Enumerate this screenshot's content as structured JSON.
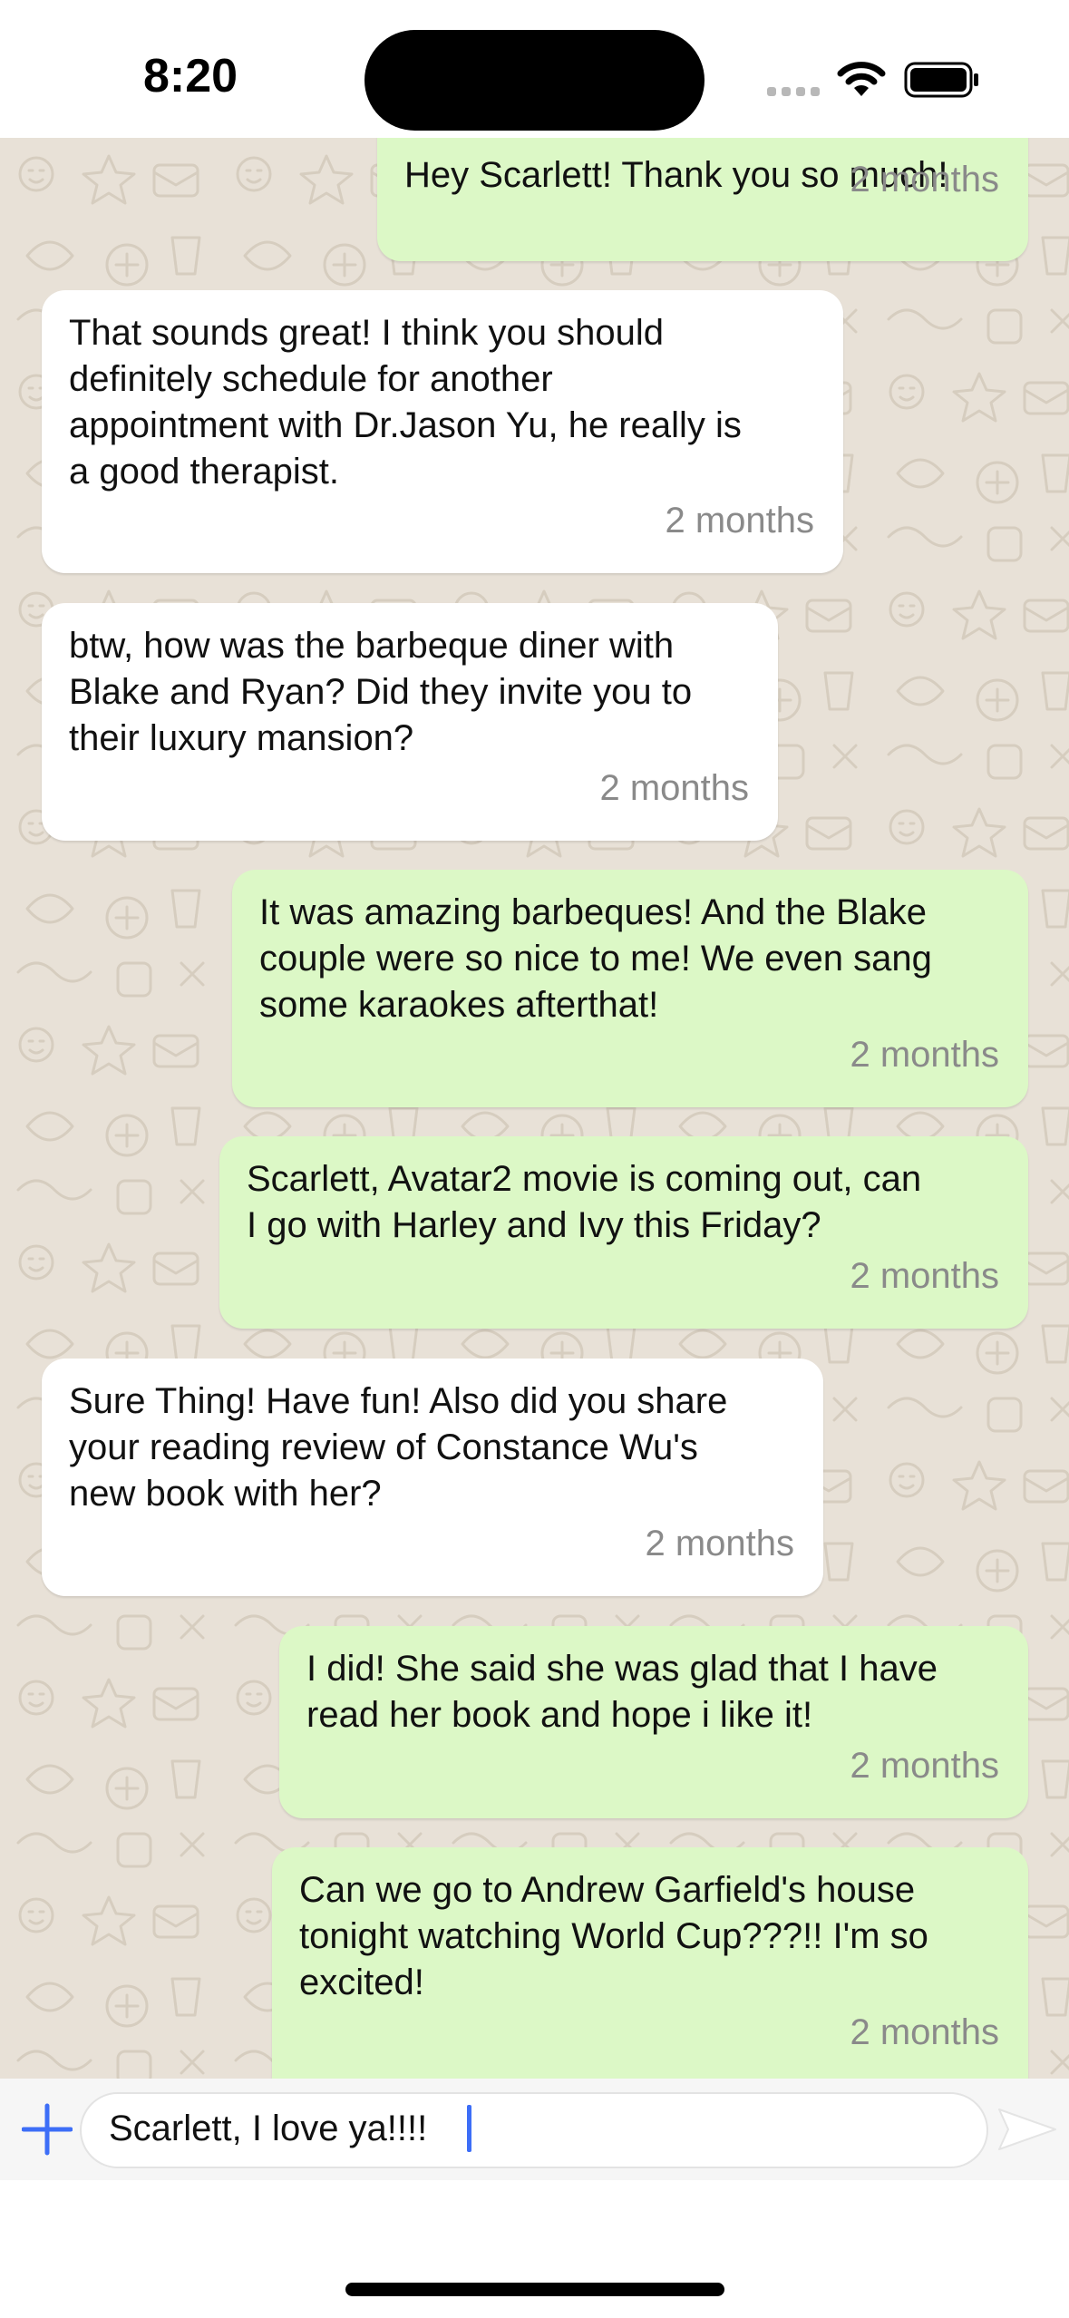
{
  "status_bar": {
    "time": "8:20"
  },
  "messages": [
    {
      "direction": "outgoing",
      "text": "Hey Scarlett! Thank you so much!",
      "time": "2 months"
    },
    {
      "direction": "incoming",
      "text": "That sounds great! I think you should\ndefinitely schedule for another\nappointment with Dr.Jason Yu, he really is\na good therapist.",
      "time": "2 months"
    },
    {
      "direction": "incoming",
      "text": "btw, how was the barbeque diner with\nBlake and Ryan? Did they invite you to\ntheir luxury mansion?",
      "time": "2 months"
    },
    {
      "direction": "outgoing",
      "text": "It was amazing barbeques! And the Blake\ncouple were so nice to me! We even sang\nsome karaokes afterthat!",
      "time": "2 months"
    },
    {
      "direction": "outgoing",
      "text": "Scarlett, Avatar2 movie is coming out, can\nI go with Harley and Ivy this Friday?",
      "time": "2 months"
    },
    {
      "direction": "incoming",
      "text": "Sure Thing! Have fun! Also did you share\nyour reading review of Constance Wu's\nnew book with her?",
      "time": "2 months"
    },
    {
      "direction": "outgoing",
      "text": "I did! She said she was glad that I have\nread her book and hope i like it!",
      "time": "2 months"
    },
    {
      "direction": "outgoing",
      "text": "Can we go to Andrew Garfield's house\ntonight watching World Cup???!! I'm so\nexcited!",
      "time": "2 months"
    }
  ],
  "composer": {
    "input_value": "Scarlett, I love ya!!!!",
    "plus_icon": "plus-icon",
    "send_icon": "send-icon"
  },
  "colors": {
    "incoming_bubble": "#ffffff",
    "outgoing_bubble": "#dcf8c6",
    "chat_background": "#e8e1d7",
    "accent": "#3d6ef7"
  }
}
